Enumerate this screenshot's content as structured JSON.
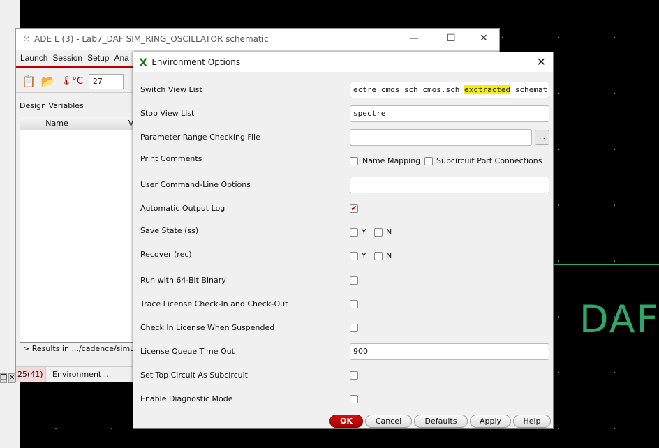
{
  "ade": {
    "title": "ADE L (3) - Lab7_DAF SIM_RING_OSCILLATOR schematic",
    "menus": [
      "Launch",
      "Session",
      "Setup",
      "Ana"
    ],
    "temperature": "27",
    "design_variables": "Design Variables",
    "columns": [
      "Name",
      "V"
    ],
    "results": "> Results in .../cadence/simulat",
    "status_count": "25(41)",
    "status_text": "Environment ..."
  },
  "dialog": {
    "title": "Environment Options",
    "switch_view_label": "Switch View List",
    "switch_view_pre": "ectre cmos_sch cmos.sch ",
    "switch_view_hl": "exctracted",
    "switch_view_post": " schemat:",
    "stop_view_label": "Stop View List",
    "stop_view_value": "spectre",
    "param_range_label": "Parameter Range Checking File",
    "browse": "...",
    "print_comments_label": "Print Comments",
    "name_mapping": "Name Mapping",
    "subckt_ports": "Subcircuit Port Connections",
    "user_cmd_label": "User Command-Line Options",
    "auto_log_label": "Automatic Output Log",
    "save_state_label": "Save State (ss)",
    "recover_label": "Recover (rec)",
    "y": "Y",
    "n": "N",
    "run64_label": "Run with 64-Bit Binary",
    "trace_label": "Trace License Check-In and Check-Out",
    "checkin_label": "Check In License When Suspended",
    "queue_label": "License Queue Time Out",
    "queue_value": "900",
    "top_subckt_label": "Set Top Circuit As Subcircuit",
    "diag_label": "Enable Diagnostic Mode",
    "buttons": {
      "ok": "OK",
      "cancel": "Cancel",
      "defaults": "Defaults",
      "apply": "Apply",
      "help": "Help"
    }
  },
  "schematic": {
    "label": "DAF"
  },
  "colors": {
    "accent": "#c00000",
    "schematic_green": "#2ea86a",
    "highlight": "#f5f000"
  }
}
